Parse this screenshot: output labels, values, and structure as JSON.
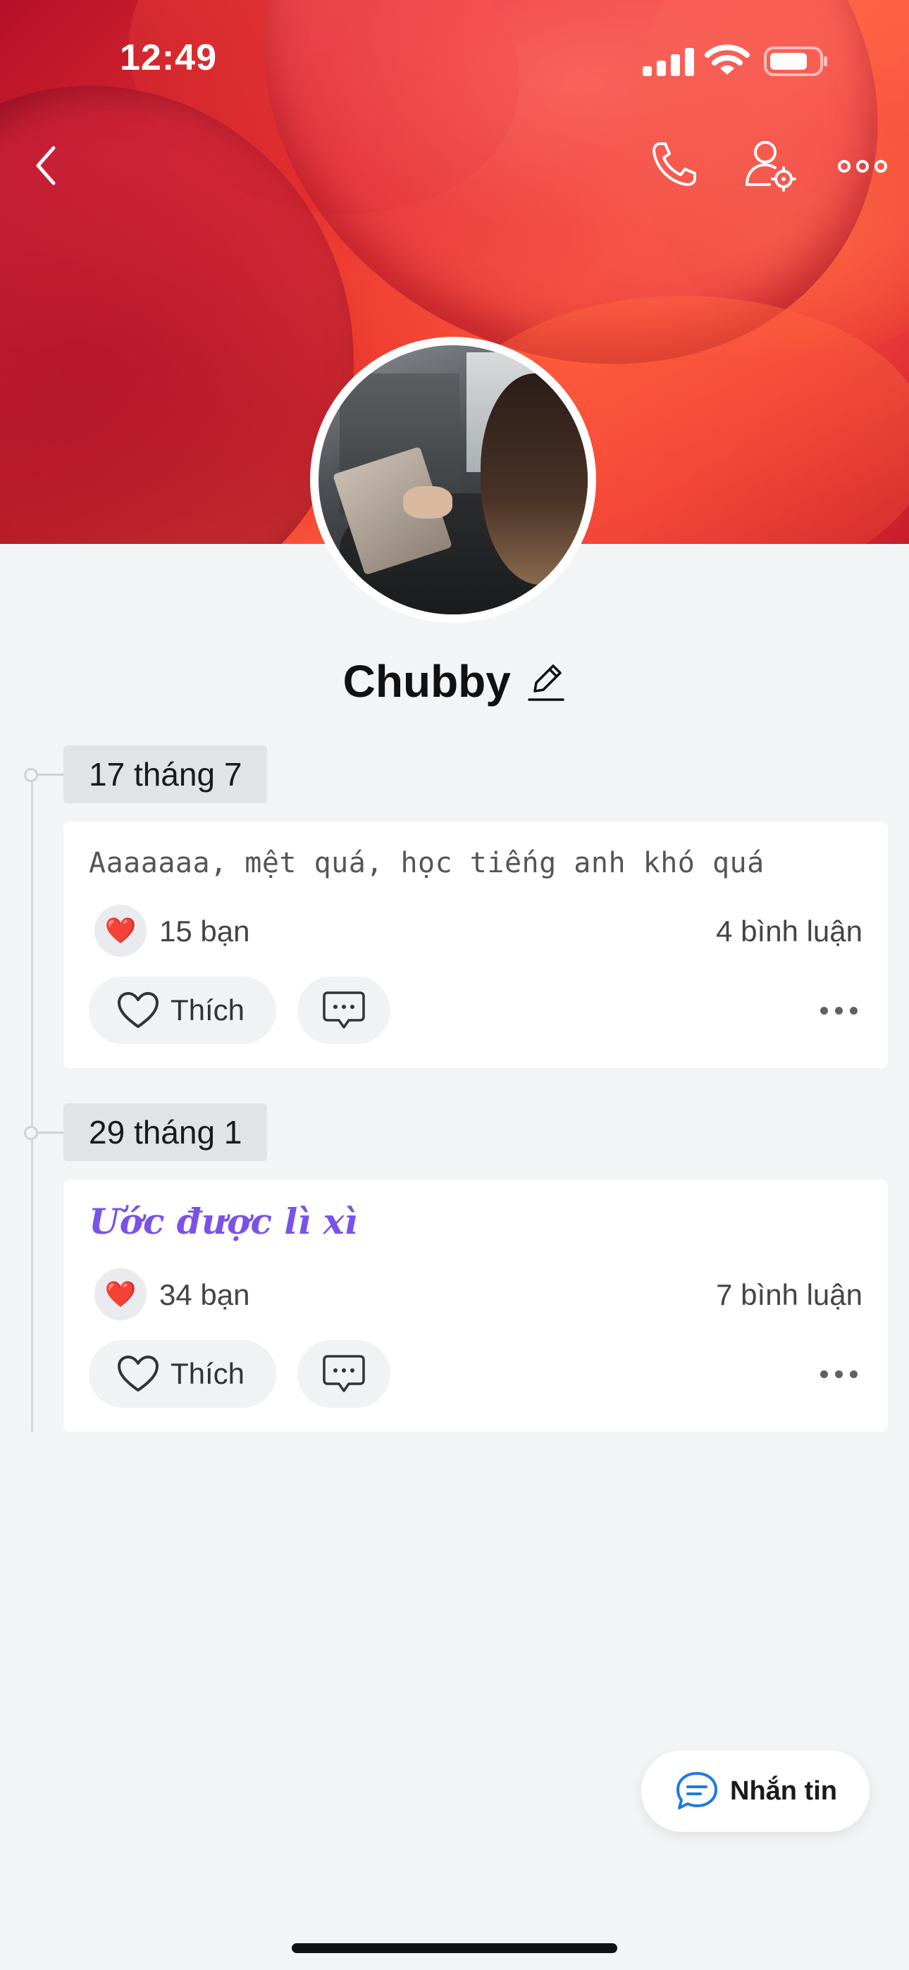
{
  "status_bar": {
    "time": "12:49"
  },
  "profile": {
    "name": "Chubby"
  },
  "colors": {
    "accent_purple": "#7b52e8",
    "heart": "#e0182d",
    "message_icon": "#1f7ae0",
    "background": "#f3f4f6"
  },
  "icons": [
    "back-chevron-icon",
    "phone-icon",
    "user-settings-icon",
    "more-horizontal-icon",
    "edit-pencil-icon",
    "heart-icon",
    "comment-icon",
    "chat-bubble-icon"
  ],
  "posts": [
    {
      "date": "17 tháng 7",
      "text": "Aaaaaaa, mệt quá, học tiếng anh khó quá",
      "reaction_emoji": "❤️",
      "likes": "15 bạn",
      "comments": "4 bình luận",
      "like_label": "Thích"
    },
    {
      "date": "29 tháng 1",
      "text": "Ước được lì xì",
      "reaction_emoji": "❤️",
      "likes": "34 bạn",
      "comments": "7 bình luận",
      "like_label": "Thích"
    }
  ],
  "message_button": {
    "label": "Nhắn tin"
  }
}
